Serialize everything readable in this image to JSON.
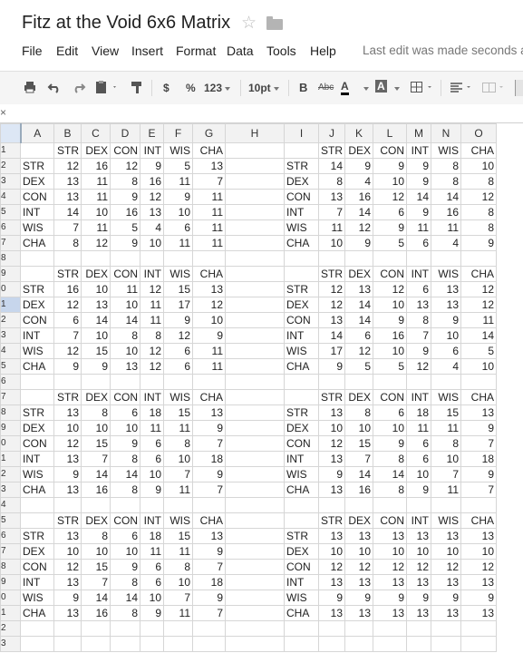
{
  "title": "Fitz at the Void 6x6 Matrix",
  "menus": [
    "File",
    "Edit",
    "View",
    "Insert",
    "Format",
    "Data",
    "Tools",
    "Help"
  ],
  "last_edit": "Last edit was made seconds a",
  "toolbar": {
    "currency": "$",
    "percent": "%",
    "numfmt": "123",
    "fontsize": "10pt",
    "bold": "B",
    "strike": "Abc",
    "fontcolor": "A",
    "fillcolor": "A"
  },
  "formula_close": "×",
  "columns": [
    "A",
    "B",
    "C",
    "D",
    "E",
    "F",
    "G",
    "H",
    "I",
    "J",
    "K",
    "L",
    "M",
    "N",
    "O"
  ],
  "row_numbers": [
    "1",
    "2",
    "3",
    "4",
    "5",
    "6",
    "7",
    "8",
    "9",
    "0",
    "1",
    "2",
    "3",
    "4",
    "5",
    "6",
    "7",
    "8",
    "9",
    "0",
    "1",
    "2",
    "3",
    "4",
    "5",
    "6",
    "7",
    "8",
    "9",
    "0",
    "1",
    "2",
    "3"
  ],
  "header_row": [
    "STR",
    "DEX",
    "CON",
    "INT",
    "WIS",
    "CHA"
  ],
  "blocks": [
    {
      "left": {
        "rows": [
          [
            "STR",
            "12",
            "16",
            "12",
            "9",
            "5",
            "13"
          ],
          [
            "DEX",
            "13",
            "11",
            "8",
            "16",
            "11",
            "7"
          ],
          [
            "CON",
            "13",
            "11",
            "9",
            "12",
            "9",
            "11"
          ],
          [
            "INT",
            "14",
            "10",
            "16",
            "13",
            "10",
            "11"
          ],
          [
            "WIS",
            "7",
            "11",
            "5",
            "4",
            "6",
            "11"
          ],
          [
            "CHA",
            "8",
            "12",
            "9",
            "10",
            "11",
            "11"
          ]
        ]
      },
      "right": {
        "rows": [
          [
            "STR",
            "14",
            "9",
            "9",
            "9",
            "8",
            "10"
          ],
          [
            "DEX",
            "8",
            "4",
            "10",
            "9",
            "8",
            "8"
          ],
          [
            "CON",
            "13",
            "16",
            "12",
            "14",
            "14",
            "12"
          ],
          [
            "INT",
            "7",
            "14",
            "6",
            "9",
            "16",
            "8"
          ],
          [
            "WIS",
            "11",
            "12",
            "9",
            "11",
            "11",
            "8"
          ],
          [
            "CHA",
            "10",
            "9",
            "5",
            "6",
            "4",
            "9"
          ]
        ]
      }
    },
    {
      "left": {
        "rows": [
          [
            "STR",
            "16",
            "10",
            "11",
            "12",
            "15",
            "13"
          ],
          [
            "DEX",
            "12",
            "13",
            "10",
            "11",
            "17",
            "12"
          ],
          [
            "CON",
            "6",
            "14",
            "14",
            "11",
            "9",
            "10"
          ],
          [
            "INT",
            "7",
            "10",
            "8",
            "8",
            "12",
            "9"
          ],
          [
            "WIS",
            "12",
            "15",
            "10",
            "12",
            "6",
            "11"
          ],
          [
            "CHA",
            "9",
            "9",
            "13",
            "12",
            "6",
            "11"
          ]
        ]
      },
      "right": {
        "rows": [
          [
            "STR",
            "12",
            "13",
            "12",
            "6",
            "13",
            "12"
          ],
          [
            "DEX",
            "12",
            "14",
            "10",
            "13",
            "13",
            "12"
          ],
          [
            "CON",
            "13",
            "14",
            "9",
            "8",
            "9",
            "11"
          ],
          [
            "INT",
            "14",
            "6",
            "16",
            "7",
            "10",
            "14"
          ],
          [
            "WIS",
            "17",
            "12",
            "10",
            "9",
            "6",
            "5"
          ],
          [
            "CHA",
            "9",
            "5",
            "5",
            "12",
            "4",
            "10"
          ]
        ]
      }
    },
    {
      "left": {
        "rows": [
          [
            "STR",
            "13",
            "8",
            "6",
            "18",
            "15",
            "13"
          ],
          [
            "DEX",
            "10",
            "10",
            "10",
            "11",
            "11",
            "9"
          ],
          [
            "CON",
            "12",
            "15",
            "9",
            "6",
            "8",
            "7"
          ],
          [
            "INT",
            "13",
            "7",
            "8",
            "6",
            "10",
            "18"
          ],
          [
            "WIS",
            "9",
            "14",
            "14",
            "10",
            "7",
            "9"
          ],
          [
            "CHA",
            "13",
            "16",
            "8",
            "9",
            "11",
            "7"
          ]
        ]
      },
      "right": {
        "rows": [
          [
            "STR",
            "13",
            "8",
            "6",
            "18",
            "15",
            "13"
          ],
          [
            "DEX",
            "10",
            "10",
            "10",
            "11",
            "11",
            "9"
          ],
          [
            "CON",
            "12",
            "15",
            "9",
            "6",
            "8",
            "7"
          ],
          [
            "INT",
            "13",
            "7",
            "8",
            "6",
            "10",
            "18"
          ],
          [
            "WIS",
            "9",
            "14",
            "14",
            "10",
            "7",
            "9"
          ],
          [
            "CHA",
            "13",
            "16",
            "8",
            "9",
            "11",
            "7"
          ]
        ]
      }
    },
    {
      "left": {
        "rows": [
          [
            "STR",
            "13",
            "8",
            "6",
            "18",
            "15",
            "13"
          ],
          [
            "DEX",
            "10",
            "10",
            "10",
            "11",
            "11",
            "9"
          ],
          [
            "CON",
            "12",
            "15",
            "9",
            "6",
            "8",
            "7"
          ],
          [
            "INT",
            "13",
            "7",
            "8",
            "6",
            "10",
            "18"
          ],
          [
            "WIS",
            "9",
            "14",
            "14",
            "10",
            "7",
            "9"
          ],
          [
            "CHA",
            "13",
            "16",
            "8",
            "9",
            "11",
            "7"
          ]
        ]
      },
      "right": {
        "rows": [
          [
            "STR",
            "13",
            "13",
            "13",
            "13",
            "13",
            "13"
          ],
          [
            "DEX",
            "10",
            "10",
            "10",
            "10",
            "10",
            "10"
          ],
          [
            "CON",
            "12",
            "12",
            "12",
            "12",
            "12",
            "12"
          ],
          [
            "INT",
            "13",
            "13",
            "13",
            "13",
            "13",
            "13"
          ],
          [
            "WIS",
            "9",
            "9",
            "9",
            "9",
            "9",
            "9"
          ],
          [
            "CHA",
            "13",
            "13",
            "13",
            "13",
            "13",
            "13"
          ]
        ]
      }
    }
  ]
}
